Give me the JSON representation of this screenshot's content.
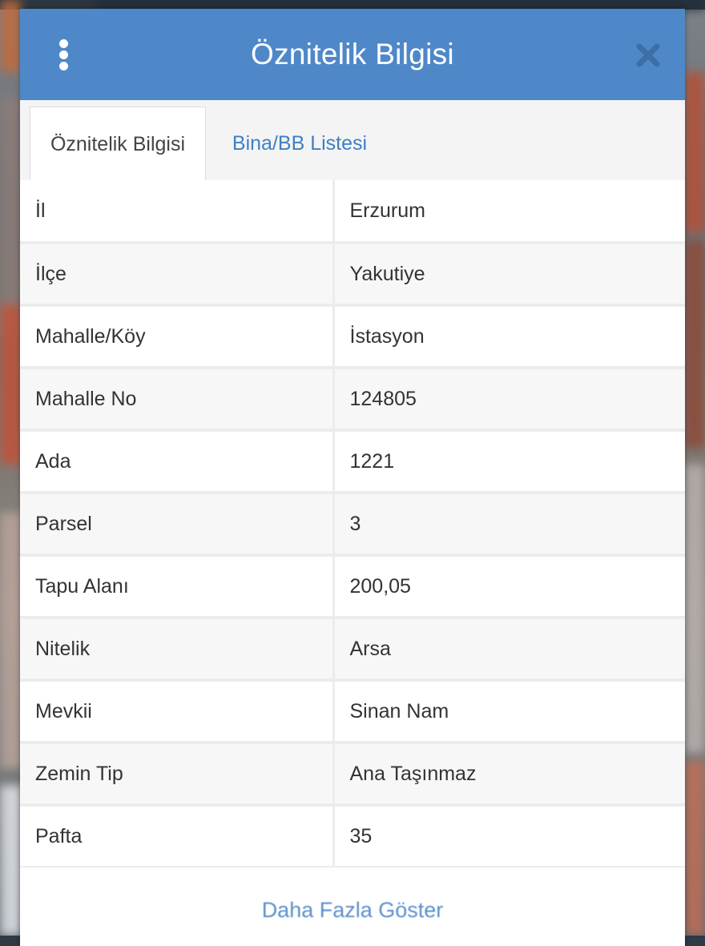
{
  "dialog": {
    "title": "Öznitelik Bilgisi",
    "menu_icon": "kebab-menu-icon",
    "close_icon": "close-icon"
  },
  "tabs": [
    {
      "label": "Öznitelik Bilgisi",
      "active": true
    },
    {
      "label": "Bina/BB Listesi",
      "active": false
    }
  ],
  "attributes": [
    {
      "key": "İl",
      "value": "Erzurum"
    },
    {
      "key": "İlçe",
      "value": "Yakutiye"
    },
    {
      "key": "Mahalle/Köy",
      "value": "İstasyon"
    },
    {
      "key": "Mahalle No",
      "value": "124805"
    },
    {
      "key": "Ada",
      "value": "1221"
    },
    {
      "key": "Parsel",
      "value": "3"
    },
    {
      "key": "Tapu Alanı",
      "value": "200,05"
    },
    {
      "key": "Nitelik",
      "value": "Arsa"
    },
    {
      "key": "Mevkii",
      "value": "Sinan Nam"
    },
    {
      "key": "Zemin Tip",
      "value": "Ana Taşınmaz"
    },
    {
      "key": "Pafta",
      "value": "35"
    }
  ],
  "footer": {
    "link_label": "Daha Fazla Göster"
  },
  "colors": {
    "header": "#4f88c9",
    "tab_link": "#3f7fc3",
    "row_border": "#ececec"
  }
}
